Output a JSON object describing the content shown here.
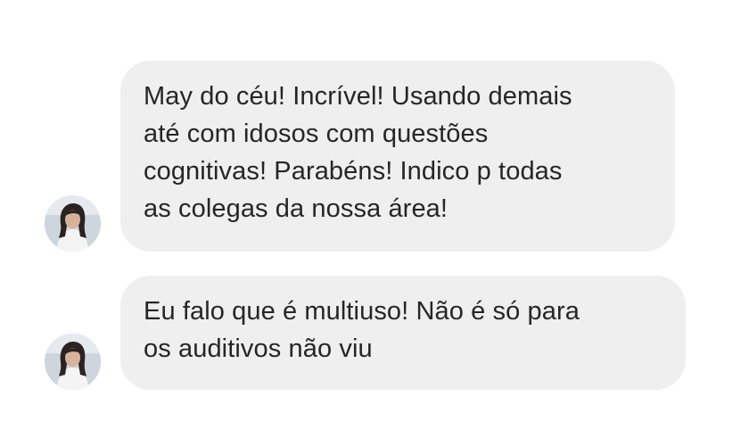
{
  "messages": [
    {
      "sender": "contact",
      "text": "May do céu! Incrível! Usando demais\naté com idosos com questões\ncognitivas! Parabéns! Indico p todas\nas colegas da nossa área!"
    },
    {
      "sender": "contact",
      "text": "Eu falo que é multiuso! Não é só para\nos auditivos não viu"
    }
  ],
  "avatar": {
    "icon": "profile-photo-avatar"
  },
  "colors": {
    "background": "#ffffff",
    "bubble": "#efefef",
    "text": "#262626"
  }
}
